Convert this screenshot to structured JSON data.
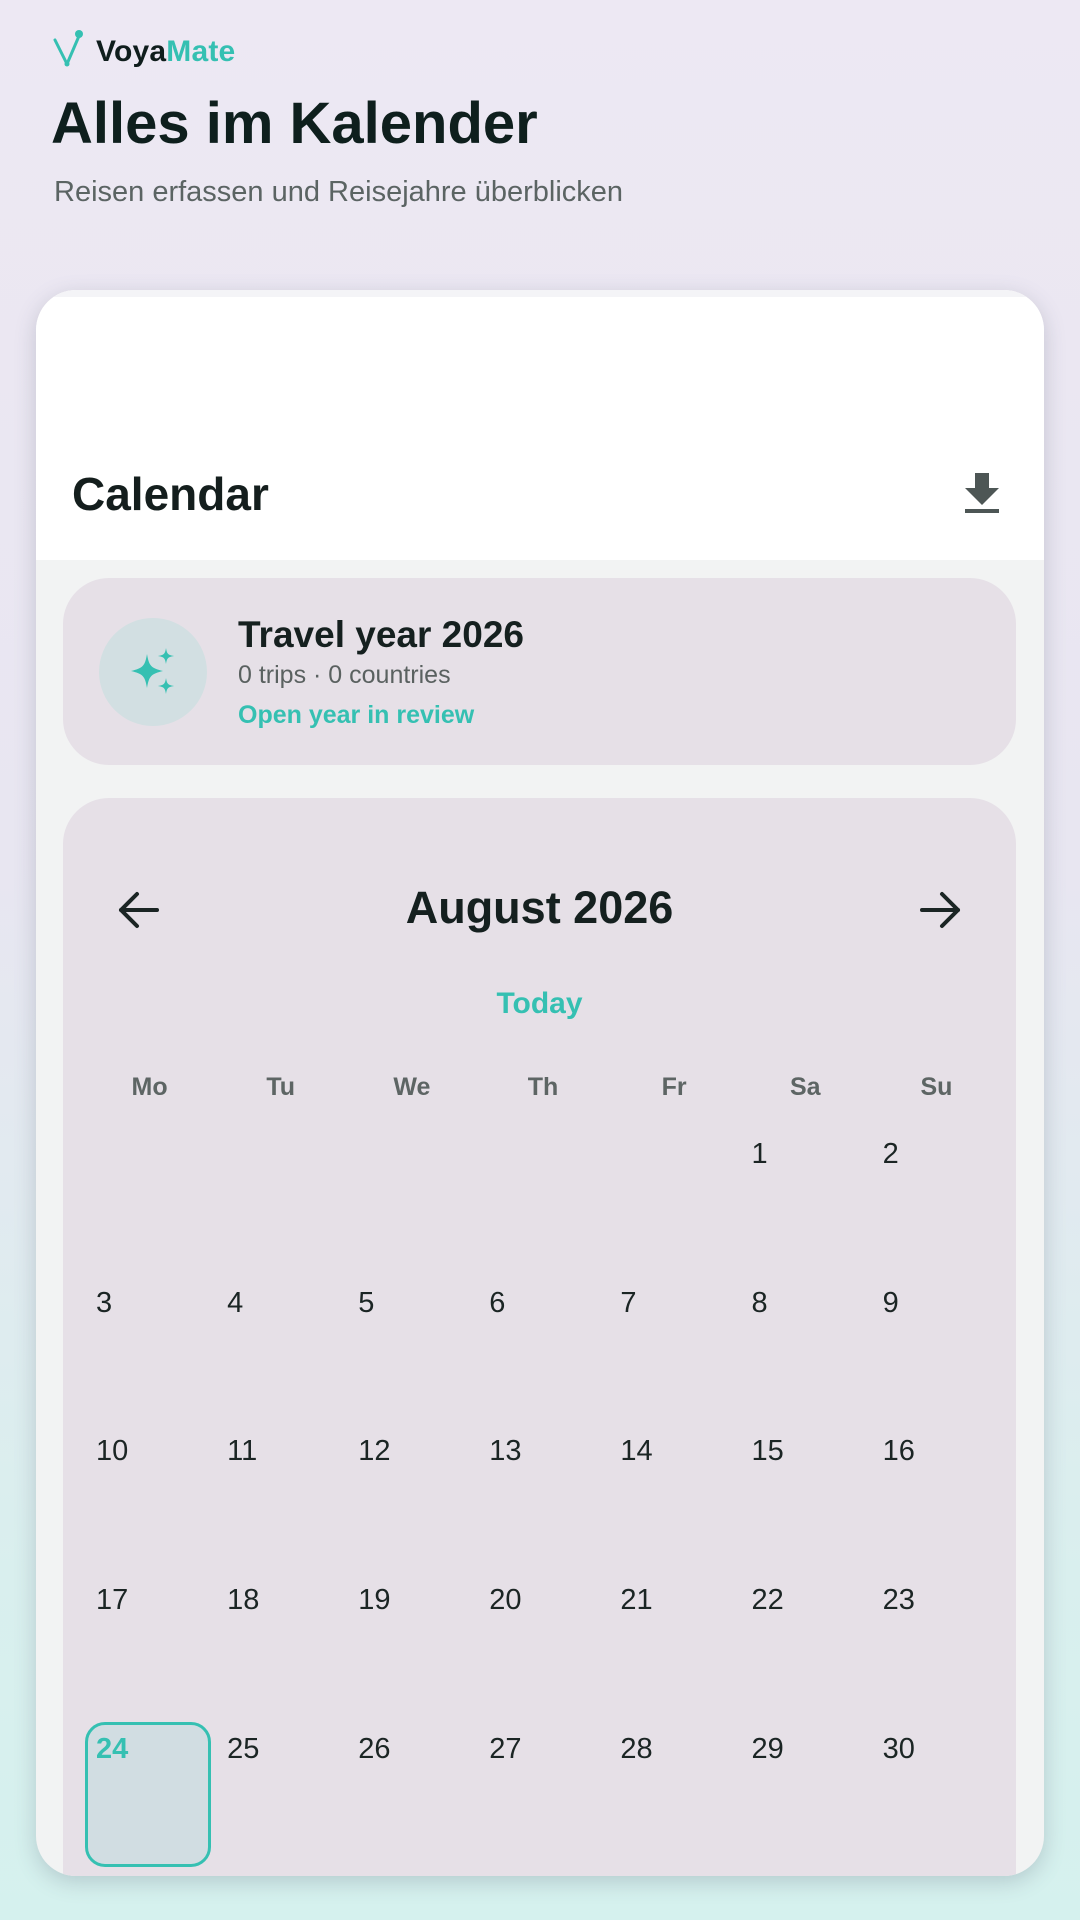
{
  "brand": {
    "name_primary": "Voya",
    "name_accent": "Mate",
    "logo_icon": "constellation-icon"
  },
  "hero": {
    "title": "Alles im Kalender",
    "subtitle": "Reisen erfassen und Reisejahre überblicken"
  },
  "appbar": {
    "title": "Calendar",
    "action_icon": "download-icon"
  },
  "year_card": {
    "icon": "sparkles-icon",
    "title": "Travel year 2026",
    "stats": "0 trips · 0 countries",
    "link": "Open year in review"
  },
  "calendar": {
    "month_title": "August 2026",
    "prev_icon": "arrow-left-icon",
    "next_icon": "arrow-right-icon",
    "today_label": "Today",
    "weekdays": [
      "Mo",
      "Tu",
      "We",
      "Th",
      "Fr",
      "Sa",
      "Su"
    ],
    "leading_blanks": 5,
    "days": [
      "1",
      "2",
      "3",
      "4",
      "5",
      "6",
      "7",
      "8",
      "9",
      "10",
      "11",
      "12",
      "13",
      "14",
      "15",
      "16",
      "17",
      "18",
      "19",
      "20",
      "21",
      "22",
      "23",
      "24",
      "25",
      "26",
      "27",
      "28",
      "29",
      "30"
    ],
    "today": "24"
  },
  "colors": {
    "accent": "#35c0b2",
    "card": "#e6e0e7",
    "text": "#15201f"
  }
}
